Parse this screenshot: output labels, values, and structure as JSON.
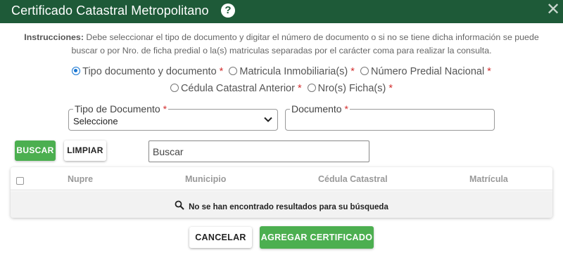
{
  "dialog": {
    "title": "Certificado Catastral Metropolitano",
    "help_icon": "question-circle-icon",
    "help_glyph": "?",
    "close_icon": "close-icon",
    "close_glyph": "✕"
  },
  "instructions": {
    "label": "Instrucciones:",
    "line1": "Debe seleccionar el tipo de documento y digitar el número de documento o si no se tiene dicha información se puede",
    "line2": "buscar o por Nro. de ficha predial o la(s) matriculas separadas por el carácter coma para realizar la consulta."
  },
  "search_options": {
    "selected": "Tipo documento y documento",
    "items": [
      {
        "label": "Tipo documento y documento",
        "required_mark": "*"
      },
      {
        "label": "Matricula Inmobiliaria(s)",
        "required_mark": "*"
      },
      {
        "label": "Número Predial Nacional",
        "required_mark": "*"
      },
      {
        "label": "Cédula Catastral Anterior",
        "required_mark": "*"
      },
      {
        "label": "Nro(s) Ficha(s)",
        "required_mark": "*"
      }
    ]
  },
  "form": {
    "tipo_documento": {
      "label": "Tipo de Documento",
      "required_mark": "*",
      "value": "Seleccione"
    },
    "documento": {
      "label": "Documento",
      "required_mark": "*",
      "value": ""
    }
  },
  "toolbar": {
    "buscar_label": "BUSCAR",
    "limpiar_label": "LIMPIAR",
    "search_placeholder": "Buscar"
  },
  "table": {
    "columns": [
      "Nupre",
      "Municipio",
      "Cédula Catastral",
      "Matrícula"
    ],
    "rows": [],
    "empty_message": "No se han encontrado resultados para su búsqueda"
  },
  "footer": {
    "cancel_label": "CANCELAR",
    "add_label": "AGREGAR CERTIFICADO"
  },
  "colors": {
    "header_bg": "#1e5a38",
    "primary_green": "#4caf50",
    "radio_selected": "#1976d2",
    "required": "#d32f2f"
  }
}
